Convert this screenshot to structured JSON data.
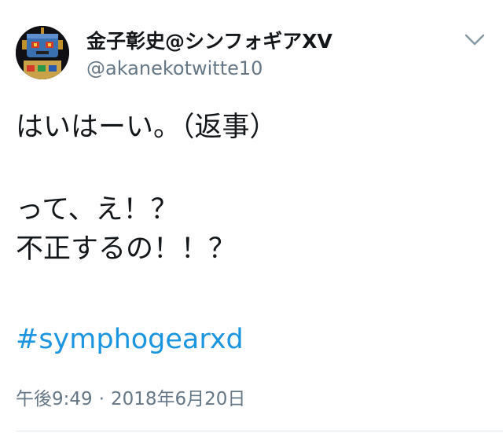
{
  "user": {
    "display_name": "金子彰史@シンフォギアXV",
    "handle": "@akanekotwitte10",
    "avatar_icon": "robot-avatar-icon"
  },
  "menu": {
    "caret_icon": "chevron-down-icon"
  },
  "tweet": {
    "lines": [
      "はいはーい。（返事）",
      "って、え！？",
      "不正するの！！？"
    ],
    "hashtag": "#symphogearxd"
  },
  "meta": {
    "time": "午後9:49",
    "separator": "·",
    "date": "2018年6月20日"
  },
  "colors": {
    "text": "#14171a",
    "secondary": "#657786",
    "link": "#1b95e0",
    "divider": "#e1e8ed"
  }
}
